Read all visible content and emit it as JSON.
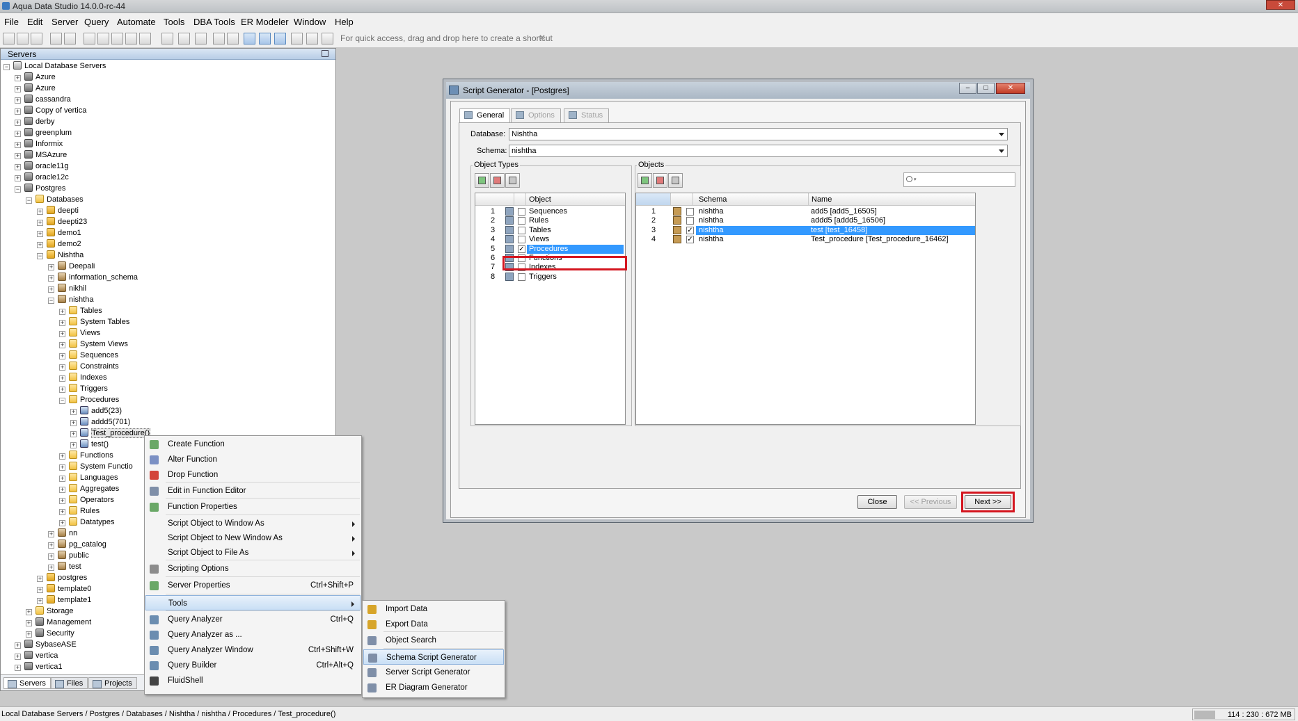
{
  "window": {
    "title": "Aqua Data Studio 14.0.0-rc-44"
  },
  "menubar": [
    "File",
    "Edit",
    "Server",
    "Query",
    "Automate",
    "Tools",
    "DBA Tools",
    "ER Modeler",
    "Window",
    "Help"
  ],
  "toolbar": {
    "quick_access": "For quick access, drag and drop here to create a shortcut",
    "close_glyph": "✕"
  },
  "servers_panel": {
    "title": "Servers",
    "tree": [
      {
        "label": "Local Database Servers",
        "icon": "root-icon"
      },
      {
        "label": "Azure",
        "icon": "server-icon"
      },
      {
        "label": "Azure",
        "icon": "server-icon"
      },
      {
        "label": "cassandra",
        "icon": "server-icon"
      },
      {
        "label": "Copy of vertica",
        "icon": "server-icon"
      },
      {
        "label": "derby",
        "icon": "server-icon"
      },
      {
        "label": "greenplum",
        "icon": "server-icon"
      },
      {
        "label": "Informix",
        "icon": "server-icon"
      },
      {
        "label": "MSAzure",
        "icon": "server-icon"
      },
      {
        "label": "oracle11g",
        "icon": "server-icon"
      },
      {
        "label": "oracle12c",
        "icon": "server-icon"
      },
      {
        "label": "Postgres",
        "icon": "server-icon"
      },
      {
        "label": "Databases",
        "icon": "folder-icon"
      },
      {
        "label": "deepti",
        "icon": "database-icon"
      },
      {
        "label": "deepti23",
        "icon": "database-icon"
      },
      {
        "label": "demo1",
        "icon": "database-icon"
      },
      {
        "label": "demo2",
        "icon": "database-icon"
      },
      {
        "label": "Nishtha",
        "icon": "database-icon"
      },
      {
        "label": "Deepali",
        "icon": "schema-icon"
      },
      {
        "label": "information_schema",
        "icon": "schema-icon"
      },
      {
        "label": "nikhil",
        "icon": "schema-icon"
      },
      {
        "label": "nishtha",
        "icon": "schema-icon"
      },
      {
        "label": "Tables",
        "icon": "folder-icon"
      },
      {
        "label": "System Tables",
        "icon": "folder-icon"
      },
      {
        "label": "Views",
        "icon": "folder-icon"
      },
      {
        "label": "System Views",
        "icon": "folder-icon"
      },
      {
        "label": "Sequences",
        "icon": "folder-icon"
      },
      {
        "label": "Constraints",
        "icon": "folder-icon"
      },
      {
        "label": "Indexes",
        "icon": "folder-icon"
      },
      {
        "label": "Triggers",
        "icon": "folder-icon"
      },
      {
        "label": "Procedures",
        "icon": "folder-icon"
      },
      {
        "label": "add5(23)",
        "icon": "procedure-icon"
      },
      {
        "label": "addd5(701)",
        "icon": "procedure-icon"
      },
      {
        "label": "Test_procedure()",
        "icon": "procedure-icon"
      },
      {
        "label": "test()",
        "icon": "procedure-icon"
      },
      {
        "label": "Functions",
        "icon": "folder-icon"
      },
      {
        "label": "System Functio",
        "icon": "folder-icon"
      },
      {
        "label": "Languages",
        "icon": "folder-icon"
      },
      {
        "label": "Aggregates",
        "icon": "folder-icon"
      },
      {
        "label": "Operators",
        "icon": "folder-icon"
      },
      {
        "label": "Rules",
        "icon": "folder-icon"
      },
      {
        "label": "Datatypes",
        "icon": "folder-icon"
      },
      {
        "label": "nn",
        "icon": "schema-icon"
      },
      {
        "label": "pg_catalog",
        "icon": "schema-icon"
      },
      {
        "label": "public",
        "icon": "schema-icon"
      },
      {
        "label": "test",
        "icon": "schema-icon"
      },
      {
        "label": "postgres",
        "icon": "database-icon"
      },
      {
        "label": "template0",
        "icon": "database-icon"
      },
      {
        "label": "template1",
        "icon": "database-icon"
      },
      {
        "label": "Storage",
        "icon": "folder-icon"
      },
      {
        "label": "Management",
        "icon": "server-icon"
      },
      {
        "label": "Security",
        "icon": "server-icon"
      },
      {
        "label": "SybaseASE",
        "icon": "server-icon"
      },
      {
        "label": "vertica",
        "icon": "server-icon"
      },
      {
        "label": "vertica1",
        "icon": "server-icon"
      }
    ],
    "bottom_tabs": [
      "Servers",
      "Files",
      "Projects"
    ]
  },
  "context_menu": {
    "items": [
      {
        "label": "Create Function",
        "shortcut": "",
        "submenu": false
      },
      {
        "label": "Alter Function",
        "shortcut": "",
        "submenu": false
      },
      {
        "label": "Drop Function",
        "shortcut": "",
        "submenu": false
      },
      {
        "label": "Edit in Function Editor",
        "shortcut": "",
        "submenu": false
      },
      {
        "label": "Function Properties",
        "shortcut": "",
        "submenu": false
      },
      {
        "label": "Script Object to Window As",
        "shortcut": "",
        "submenu": true
      },
      {
        "label": "Script Object to New Window As",
        "shortcut": "",
        "submenu": true
      },
      {
        "label": "Script Object to File As",
        "shortcut": "",
        "submenu": true
      },
      {
        "label": "Scripting Options",
        "shortcut": "",
        "submenu": false
      },
      {
        "label": "Server Properties",
        "shortcut": "Ctrl+Shift+P",
        "submenu": false
      },
      {
        "label": "Tools",
        "shortcut": "",
        "submenu": true
      },
      {
        "label": "Query Analyzer",
        "shortcut": "Ctrl+Q",
        "submenu": false
      },
      {
        "label": "Query Analyzer as ...",
        "shortcut": "",
        "submenu": false
      },
      {
        "label": "Query Analyzer Window",
        "shortcut": "Ctrl+Shift+W",
        "submenu": false
      },
      {
        "label": "Query Builder",
        "shortcut": "Ctrl+Alt+Q",
        "submenu": false
      },
      {
        "label": "FluidShell",
        "shortcut": "",
        "submenu": false
      }
    ]
  },
  "tools_submenu": {
    "items": [
      "Import Data",
      "Export Data",
      "Object Search",
      "Schema Script Generator",
      "Server Script Generator",
      "ER Diagram Generator"
    ]
  },
  "dialog": {
    "title": "Script Generator - [Postgres]",
    "tabs": [
      "General",
      "Options",
      "Status"
    ],
    "database_label": "Database:",
    "database_value": "Nishtha",
    "schema_label": "Schema:",
    "schema_value": "nishtha",
    "object_types": {
      "group_label": "Object Types",
      "column": "Object",
      "rows": [
        {
          "n": "1",
          "label": "Sequences",
          "checked": false
        },
        {
          "n": "2",
          "label": "Rules",
          "checked": false
        },
        {
          "n": "3",
          "label": "Tables",
          "checked": false
        },
        {
          "n": "4",
          "label": "Views",
          "checked": false
        },
        {
          "n": "5",
          "label": "Procedures",
          "checked": true
        },
        {
          "n": "6",
          "label": "Functions",
          "checked": false
        },
        {
          "n": "7",
          "label": "Indexes",
          "checked": false
        },
        {
          "n": "8",
          "label": "Triggers",
          "checked": false
        }
      ]
    },
    "objects": {
      "group_label": "Objects",
      "columns": [
        "Schema",
        "Name"
      ],
      "rows": [
        {
          "n": "1",
          "schema": "nishtha",
          "name": "add5 [add5_16505]",
          "checked": false
        },
        {
          "n": "2",
          "schema": "nishtha",
          "name": "addd5 [addd5_16506]",
          "checked": false
        },
        {
          "n": "3",
          "schema": "nishtha",
          "name": "test [test_16458]",
          "checked": true
        },
        {
          "n": "4",
          "schema": "nishtha",
          "name": "Test_procedure [Test_procedure_16462]",
          "checked": true
        }
      ]
    },
    "buttons": {
      "close": "Close",
      "previous": "<< Previous",
      "next": "Next >>"
    }
  },
  "statusbar": {
    "path": "Local Database Servers / Postgres / Databases / Nishtha / nishtha / Procedures / Test_procedure()",
    "memory": "114 : 230 : 672 MB"
  },
  "colors": {
    "selection": "#3399ff",
    "highlight_box": "#d4151f",
    "panel_header": "#b7cde6"
  }
}
